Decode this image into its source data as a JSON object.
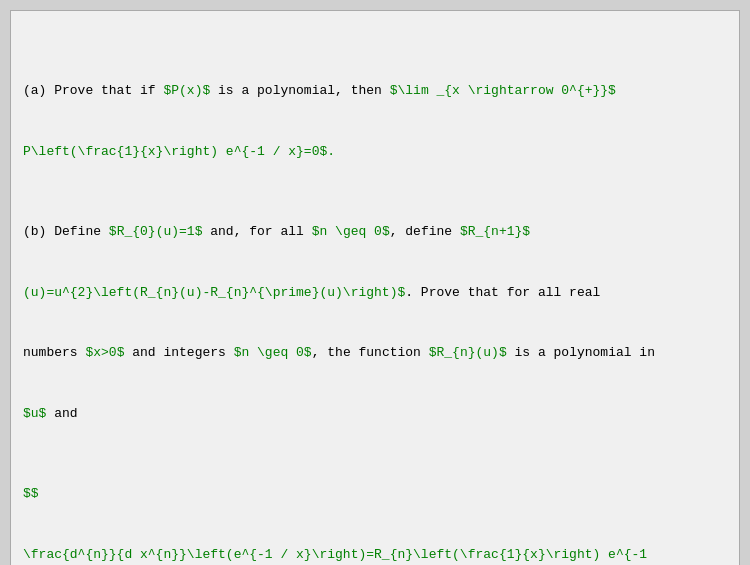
{
  "content": {
    "lines": [
      {
        "type": "mixed",
        "id": "line1"
      },
      {
        "type": "mixed",
        "id": "line2"
      },
      {
        "type": "mixed",
        "id": "line3"
      },
      {
        "type": "mixed",
        "id": "line4"
      },
      {
        "type": "mixed",
        "id": "line5"
      },
      {
        "type": "mixed",
        "id": "line6"
      },
      {
        "type": "mixed",
        "id": "line7"
      },
      {
        "type": "mixed",
        "id": "line8"
      },
      {
        "type": "mixed",
        "id": "line9"
      },
      {
        "type": "mixed",
        "id": "line10"
      }
    ],
    "code_id": "CS.JG.084"
  }
}
